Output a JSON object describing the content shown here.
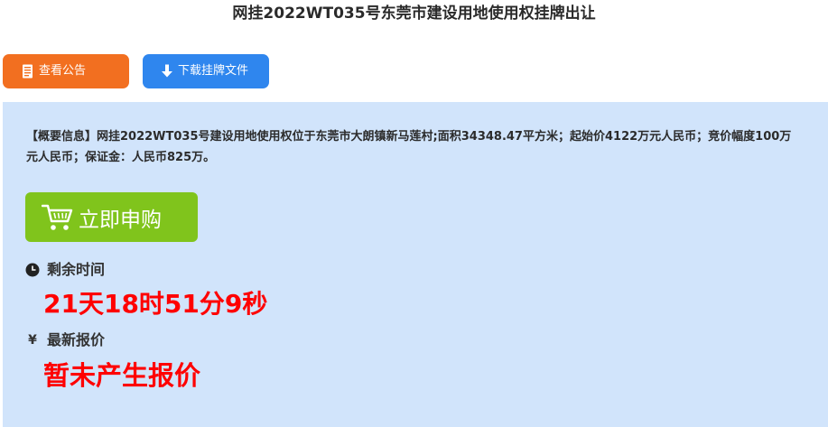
{
  "page": {
    "title": "网挂2022WT035号东莞市建设用地使用权挂牌出让"
  },
  "actions": {
    "announcement_label": "查看公告",
    "download_label": "下载挂牌文件"
  },
  "summary": {
    "text": "【概要信息】网挂2022WT035号建设用地使用权位于东莞市大朗镇新马莲村;面积34348.47平方米；起始价4122万元人民币；竞价幅度100万元人民币；保证金：人民币825万。"
  },
  "purchase": {
    "button_label": "立即申购"
  },
  "remaining": {
    "label": "剩余时间",
    "value": "21天18时51分9秒"
  },
  "latest_offer": {
    "currency_symbol": "¥",
    "label": "最新报价",
    "value": "暂未产生报价"
  },
  "colors": {
    "announce_button": "#f26f20",
    "download_button": "#2f86ee",
    "panel_background": "#d1e4fb",
    "buy_button": "#80c41c",
    "highlight_red": "#ff0000"
  },
  "icons": {
    "announcement": "document-icon",
    "download": "download-arrow-icon",
    "buy": "shopping-cart-icon",
    "remaining": "clock-icon"
  }
}
